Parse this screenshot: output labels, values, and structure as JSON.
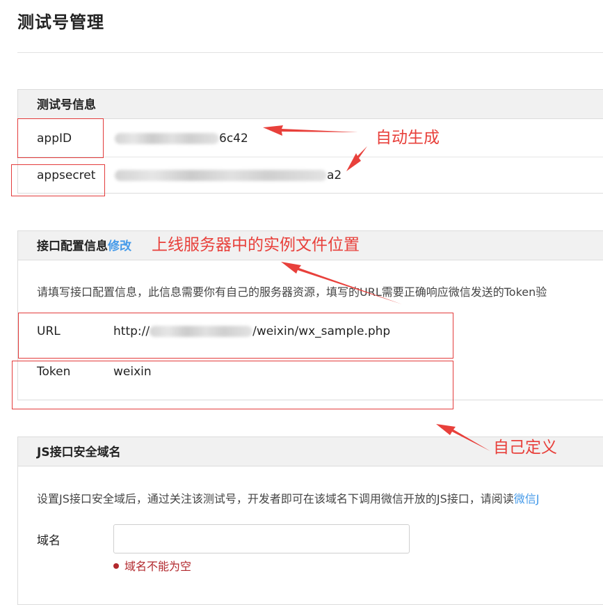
{
  "page": {
    "title": "测试号管理"
  },
  "test_account": {
    "header": "测试号信息",
    "rows": [
      {
        "label": "appID",
        "value_visible": "6c42"
      },
      {
        "label": "appsecret",
        "value_visible": "a2"
      }
    ]
  },
  "interface_config": {
    "header": "接口配置信息",
    "edit_link": "修改",
    "description": "请填写接口配置信息，此信息需要你有自己的服务器资源，填写的URL需要正确响应微信发送的Token验",
    "url_label": "URL",
    "url_prefix": "http://",
    "url_suffix": "/weixin/wx_sample.php",
    "token_label": "Token",
    "token_value": "weixin"
  },
  "js_domain": {
    "header": "JS接口安全域名",
    "description": "设置JS接口安全域后，通过关注该测试号，开发者即可在该域名下调用微信开放的JS接口，请阅读",
    "description_link": "微信J",
    "domain_label": "域名",
    "domain_placeholder": "",
    "error_text": "域名不能为空"
  },
  "annotations": {
    "auto_generate": "自动生成",
    "server_location": "上线服务器中的实例文件位置",
    "self_defined": "自己定义"
  },
  "colors": {
    "annotation": "#e8403b",
    "link": "#459ae9",
    "error": "#b2282d"
  }
}
